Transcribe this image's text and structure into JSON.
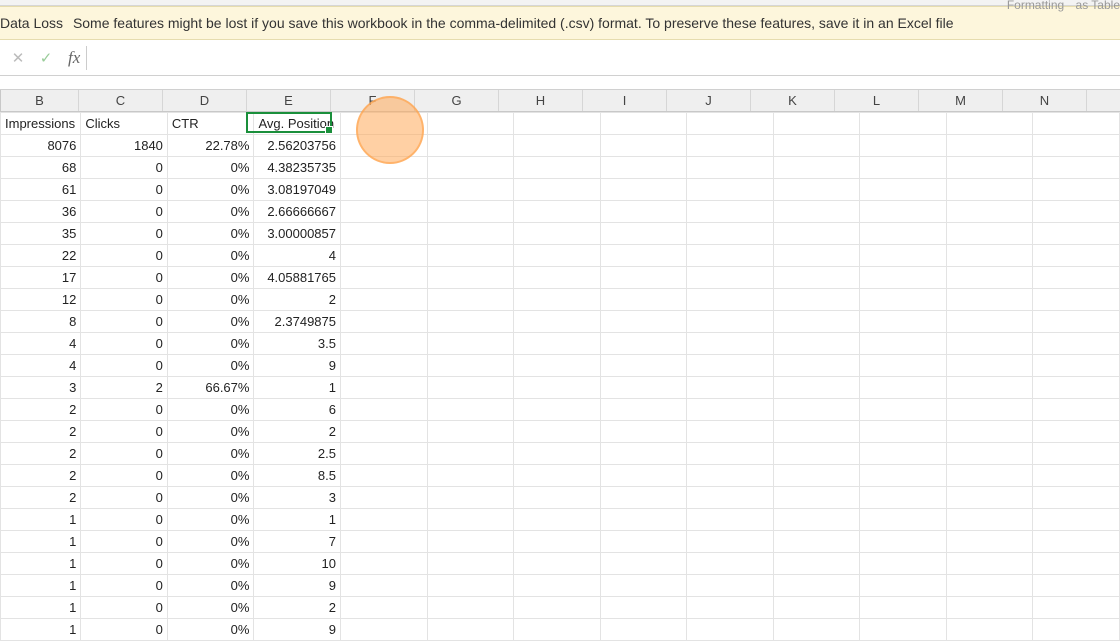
{
  "ribbon": {
    "formatting": "Formatting",
    "as_table": "as Table"
  },
  "warning": {
    "title": "Data Loss",
    "message": "Some features might be lost if you save this workbook in the comma-delimited (.csv) format. To preserve these features, save it in an Excel file"
  },
  "formula_bar": {
    "cancel": "✕",
    "confirm": "✓",
    "fx": "fx",
    "value": ""
  },
  "columns": [
    "B",
    "C",
    "D",
    "E",
    "F",
    "G",
    "H",
    "I",
    "J",
    "K",
    "L",
    "M",
    "N"
  ],
  "headers": {
    "b": "Impressions",
    "c": "Clicks",
    "d": "CTR",
    "e": "Avg. Position"
  },
  "chart_data": {
    "type": "table",
    "columns": [
      "Impressions",
      "Clicks",
      "CTR",
      "Avg. Position"
    ],
    "rows": [
      {
        "impressions": "8076",
        "clicks": "1840",
        "ctr": "22.78%",
        "avg": "2.56203756"
      },
      {
        "impressions": "68",
        "clicks": "0",
        "ctr": "0%",
        "avg": "4.38235735"
      },
      {
        "impressions": "61",
        "clicks": "0",
        "ctr": "0%",
        "avg": "3.08197049"
      },
      {
        "impressions": "36",
        "clicks": "0",
        "ctr": "0%",
        "avg": "2.66666667"
      },
      {
        "impressions": "35",
        "clicks": "0",
        "ctr": "0%",
        "avg": "3.00000857"
      },
      {
        "impressions": "22",
        "clicks": "0",
        "ctr": "0%",
        "avg": "4"
      },
      {
        "impressions": "17",
        "clicks": "0",
        "ctr": "0%",
        "avg": "4.05881765"
      },
      {
        "impressions": "12",
        "clicks": "0",
        "ctr": "0%",
        "avg": "2"
      },
      {
        "impressions": "8",
        "clicks": "0",
        "ctr": "0%",
        "avg": "2.3749875"
      },
      {
        "impressions": "4",
        "clicks": "0",
        "ctr": "0%",
        "avg": "3.5"
      },
      {
        "impressions": "4",
        "clicks": "0",
        "ctr": "0%",
        "avg": "9"
      },
      {
        "impressions": "3",
        "clicks": "2",
        "ctr": "66.67%",
        "avg": "1"
      },
      {
        "impressions": "2",
        "clicks": "0",
        "ctr": "0%",
        "avg": "6"
      },
      {
        "impressions": "2",
        "clicks": "0",
        "ctr": "0%",
        "avg": "2"
      },
      {
        "impressions": "2",
        "clicks": "0",
        "ctr": "0%",
        "avg": "2.5"
      },
      {
        "impressions": "2",
        "clicks": "0",
        "ctr": "0%",
        "avg": "8.5"
      },
      {
        "impressions": "2",
        "clicks": "0",
        "ctr": "0%",
        "avg": "3"
      },
      {
        "impressions": "1",
        "clicks": "0",
        "ctr": "0%",
        "avg": "1"
      },
      {
        "impressions": "1",
        "clicks": "0",
        "ctr": "0%",
        "avg": "7"
      },
      {
        "impressions": "1",
        "clicks": "0",
        "ctr": "0%",
        "avg": "10"
      },
      {
        "impressions": "1",
        "clicks": "0",
        "ctr": "0%",
        "avg": "9"
      },
      {
        "impressions": "1",
        "clicks": "0",
        "ctr": "0%",
        "avg": "2"
      },
      {
        "impressions": "1",
        "clicks": "0",
        "ctr": "0%",
        "avg": "9"
      }
    ]
  }
}
